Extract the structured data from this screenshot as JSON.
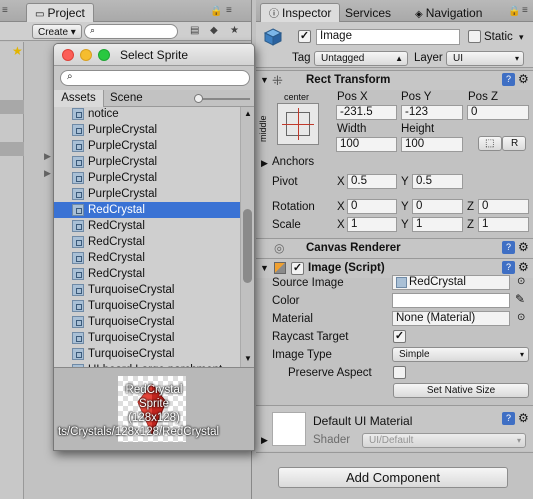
{
  "project": {
    "tab_label": "Project",
    "create_label": "Create ▾",
    "search_placeholder": ""
  },
  "inspector": {
    "tabs": [
      {
        "label": "Inspector"
      },
      {
        "label": "Services"
      },
      {
        "label": "Navigation"
      }
    ],
    "gameobject": {
      "name": "Image",
      "static_label": "Static",
      "tag_label": "Tag",
      "tag_value": "Untagged",
      "layer_label": "Layer",
      "layer_value": "UI"
    },
    "rect_transform": {
      "title": "Rect Transform",
      "anchor_preset_top": "center",
      "anchor_preset_side": "middle",
      "pos_x_label": "Pos X",
      "pos_y_label": "Pos Y",
      "pos_z_label": "Pos Z",
      "pos_x": "-231.5",
      "pos_y": "-123",
      "pos_z": "0",
      "width_label": "Width",
      "height_label": "Height",
      "width": "100",
      "height": "100",
      "r_label": "R",
      "anchors_label": "Anchors",
      "pivot_label": "Pivot",
      "pivot_x": "0.5",
      "pivot_y": "0.5",
      "rotation_label": "Rotation",
      "rot_x": "0",
      "rot_y": "0",
      "rot_z": "0",
      "scale_label": "Scale",
      "scale_x": "1",
      "scale_y": "1",
      "scale_z": "1",
      "x": "X",
      "y": "Y",
      "z": "Z"
    },
    "canvas_renderer": {
      "title": "Canvas Renderer"
    },
    "image_script": {
      "title": "Image (Script)",
      "source_image_label": "Source Image",
      "source_image_value": "RedCrystal",
      "color_label": "Color",
      "material_label": "Material",
      "material_value": "None (Material)",
      "raycast_label": "Raycast Target",
      "image_type_label": "Image Type",
      "image_type_value": "Simple",
      "preserve_aspect_label": "Preserve Aspect",
      "set_native_size_label": "Set Native Size"
    },
    "material_section": {
      "title": "Default UI Material",
      "shader_label": "Shader",
      "shader_value": "UI/Default"
    },
    "add_component_label": "Add Component"
  },
  "dialog": {
    "title": "Select Sprite",
    "search_value": "",
    "tab_assets": "Assets",
    "tab_scene": "Scene",
    "items": [
      {
        "label": "notice"
      },
      {
        "label": "PurpleCrystal"
      },
      {
        "label": "PurpleCrystal"
      },
      {
        "label": "PurpleCrystal"
      },
      {
        "label": "PurpleCrystal"
      },
      {
        "label": "PurpleCrystal"
      },
      {
        "label": "RedCrystal",
        "selected": true
      },
      {
        "label": "RedCrystal"
      },
      {
        "label": "RedCrystal"
      },
      {
        "label": "RedCrystal"
      },
      {
        "label": "RedCrystal"
      },
      {
        "label": "TurquoiseCrystal"
      },
      {
        "label": "TurquoiseCrystal"
      },
      {
        "label": "TurquoiseCrystal"
      },
      {
        "label": "TurquoiseCrystal"
      },
      {
        "label": "TurquoiseCrystal"
      },
      {
        "label": "UI board Large  parchment"
      }
    ],
    "preview_line1": "RedCrystal",
    "preview_line2": "Sprite",
    "preview_line3": "(128x128)",
    "preview_path": "ts/Crystals/128x128/RedCrystal"
  },
  "colors": {
    "selection": "#3a72d4",
    "close_light": "#fc5e57",
    "min_light": "#f5bd2f",
    "max_light": "#29c840"
  }
}
